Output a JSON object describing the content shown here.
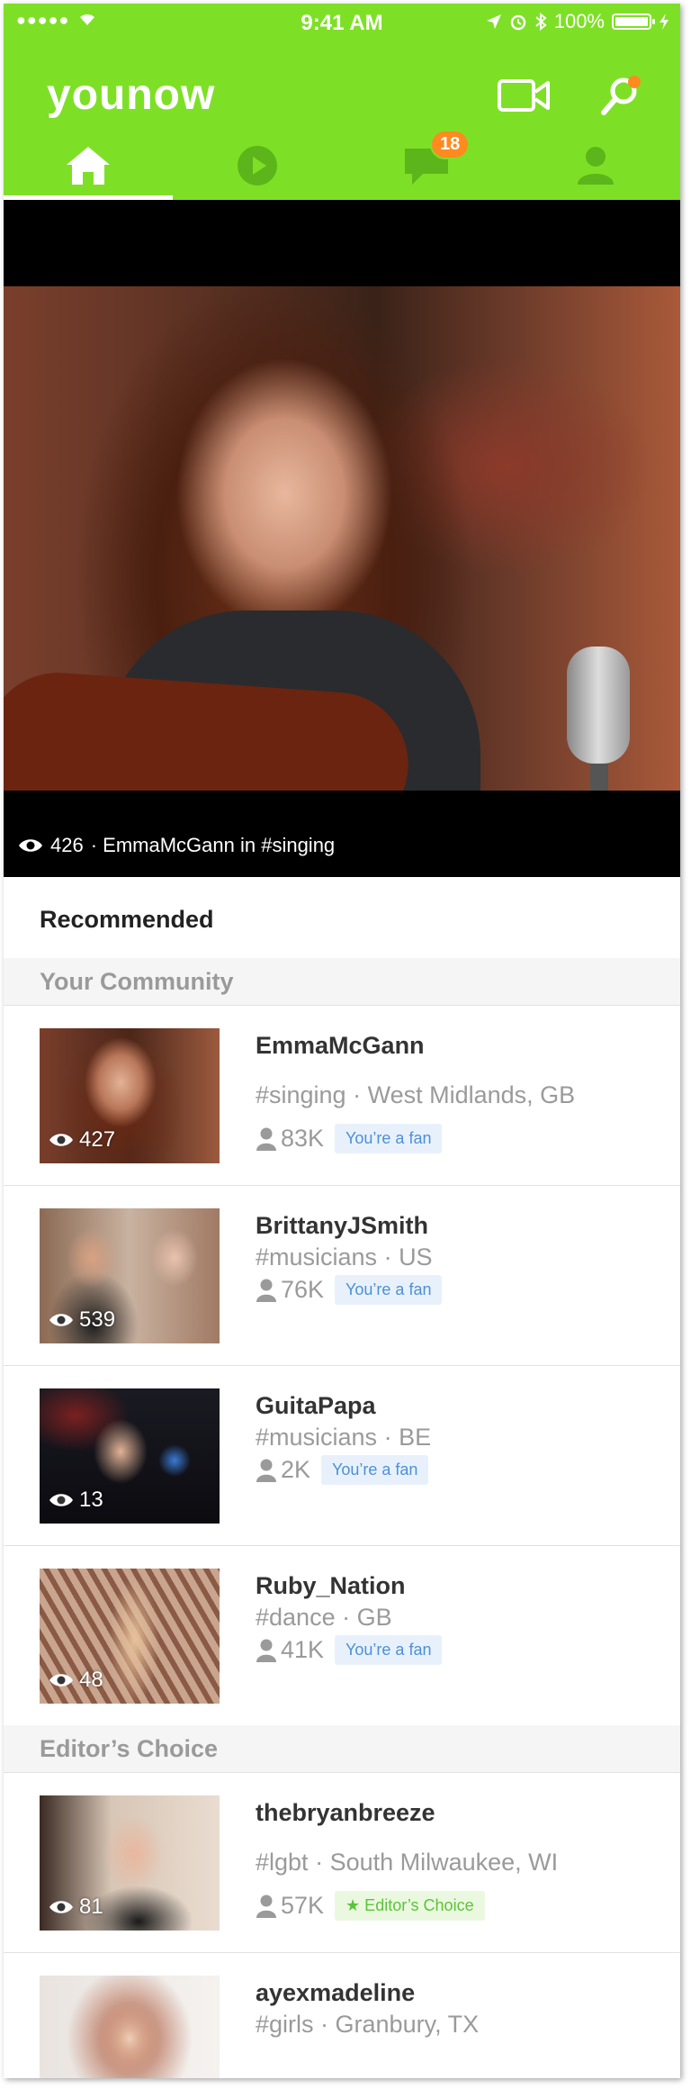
{
  "status_bar": {
    "signal": "●●●●●",
    "time": "9:41 AM",
    "battery_label": "100%"
  },
  "header": {
    "logo": "younow",
    "tabs": [
      {
        "icon": "home-icon",
        "active": true
      },
      {
        "icon": "play-icon",
        "active": false
      },
      {
        "icon": "chat-icon",
        "active": false,
        "badge": "18"
      },
      {
        "icon": "profile-icon",
        "active": false
      }
    ],
    "colors": {
      "brand": "#7ee026",
      "badge": "#ff8a1f"
    }
  },
  "featured": {
    "views": "426",
    "caption": "· EmmaMcGann in #singing"
  },
  "recommended_title": "Recommended",
  "sections": {
    "community": "Your Community",
    "editors": "Editor’s Choice"
  },
  "community": [
    {
      "name": "EmmaMcGann",
      "tag": "#singing",
      "location": "West Midlands, GB",
      "views": "427",
      "fans": "83K",
      "badge": "You’re a fan"
    },
    {
      "name": "BrittanyJSmith",
      "tag": "#musicians",
      "location": "US",
      "views": "539",
      "fans": "76K",
      "badge": "You’re a fan"
    },
    {
      "name": "GuitaPapa",
      "tag": "#musicians",
      "location": "BE",
      "views": "13",
      "fans": "2K",
      "badge": "You’re a fan"
    },
    {
      "name": "Ruby_Nation",
      "tag": "#dance",
      "location": "GB",
      "views": "48",
      "fans": "41K",
      "badge": "You’re a fan"
    }
  ],
  "editors": [
    {
      "name": "thebryanbreeze",
      "tag": "#lgbt",
      "location": "South Milwaukee, WI",
      "views": "81",
      "fans": "57K",
      "badge": "★ Editor’s Choice"
    },
    {
      "name": "ayexmadeline",
      "tag": "#girls",
      "location": "Granbury, TX"
    }
  ],
  "separator": " · "
}
